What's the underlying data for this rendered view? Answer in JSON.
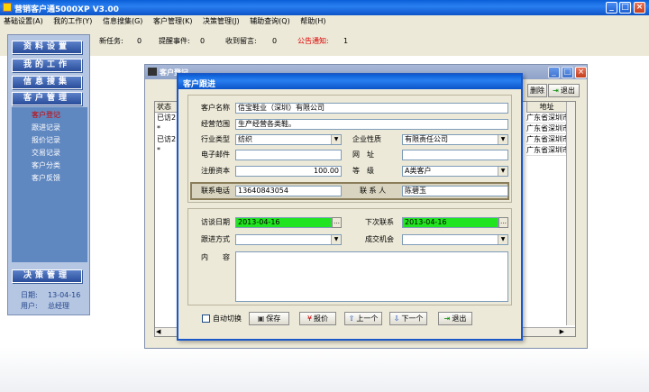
{
  "app": {
    "title": "营销客户通5000XP V3.00"
  },
  "menu": [
    "基础设置(A)",
    "我的工作(Y)",
    "信息搜集(G)",
    "客户管理(K)",
    "决策管理(J)",
    "辅助查询(Q)",
    "帮助(H)"
  ],
  "status": {
    "new_task_label": "新任务:",
    "new_task": "0",
    "reminder_label": "提醒事件:",
    "reminder": "0",
    "message_label": "收到留言:",
    "message": "0",
    "notice_label": "公告通知:",
    "notice": "1"
  },
  "sidebar": {
    "buttons": [
      "资料设置",
      "我的工作",
      "信息搜集",
      "客户管理"
    ],
    "sub_items": [
      "客户登记",
      "跟进记录",
      "报价记录",
      "交易记录",
      "客户分类",
      "客户反馈"
    ],
    "decision": "决策管理",
    "date_label": "日期:",
    "date": "13-04-16",
    "user_label": "用户:",
    "user": "总经理"
  },
  "bg_window": {
    "title": "客户登记",
    "col_status": "状态",
    "col_address": "地址",
    "rows": [
      "已访2",
      "*",
      "已访2",
      "*"
    ],
    "addresses": [
      "广东省深圳市龙",
      "广东省深圳市龙",
      "广东省深圳市龙",
      "广东省深圳市龙"
    ],
    "delete_label": "删除",
    "exit_label": "退出"
  },
  "dialog": {
    "title": "客户跟进",
    "customer_name_label": "客户名称",
    "customer_name": "信宝鞋业（深圳）有限公司",
    "business_label": "经营范围",
    "business": "生产经营各类鞋。",
    "industry_label": "行业类型",
    "industry": "纺织",
    "company_type_label": "企业性质",
    "company_type": "有限责任公司",
    "email_label": "电子邮件",
    "email": "",
    "website_label": "网　址",
    "website": "",
    "capital_label": "注册资本",
    "capital": "100.00",
    "level_label": "等　级",
    "level": "A类客户",
    "phone_label": "联系电话",
    "phone": "13640843054",
    "contact_label": "联 系 人",
    "contact": "陈碧玉",
    "visit_date_label": "访谈日期",
    "visit_date": "2013-04-16",
    "next_contact_label": "下次联系",
    "next_contact": "2013-04-16",
    "follow_method_label": "跟进方式",
    "follow_method": "",
    "deal_chance_label": "成交机会",
    "deal_chance": "",
    "content_label": "内　　容",
    "content": "",
    "auto_switch_label": "自动切换",
    "save_label": "保存",
    "quote_label": "报价",
    "prev_label": "上一个",
    "next_label": "下一个",
    "exit_label": "退出"
  },
  "colors": {
    "xp_blue": "#0a5fd8",
    "sidebar": "#b5c6e3",
    "dialog_bg": "#ece9d8",
    "date_green": "#21e421"
  }
}
